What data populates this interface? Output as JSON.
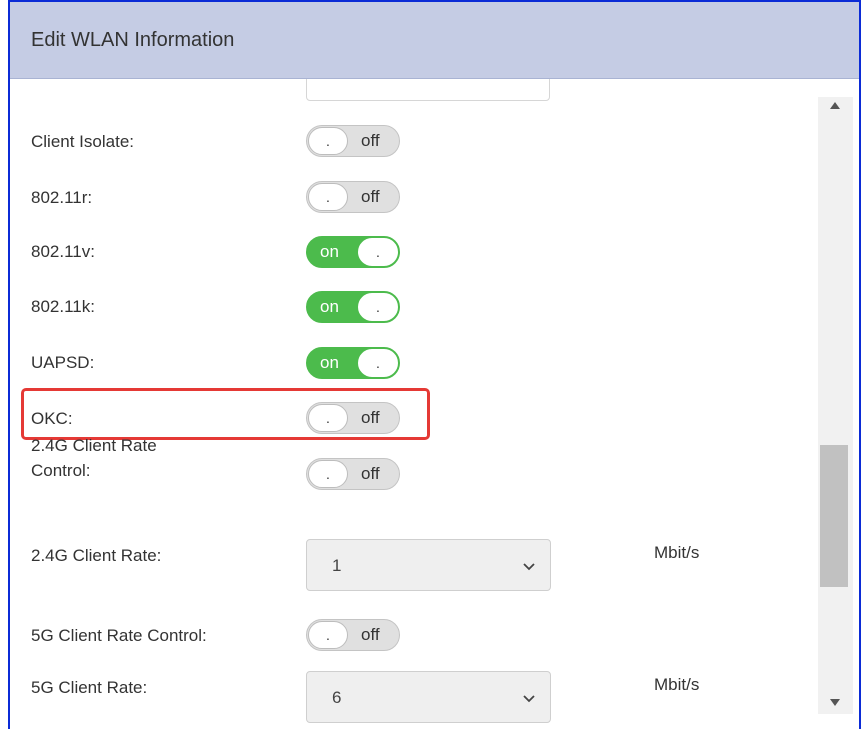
{
  "dialog": {
    "title": "Edit WLAN Information"
  },
  "rows": [
    {
      "label": "Client Isolate:",
      "state": "off",
      "knob": "."
    },
    {
      "label": "802.11r:",
      "state": "off",
      "knob": "."
    },
    {
      "label": "802.11v:",
      "state": "on",
      "knob": "."
    },
    {
      "label": "802.11k:",
      "state": "on",
      "knob": "."
    },
    {
      "label": "UAPSD:",
      "state": "on",
      "knob": "."
    },
    {
      "label": "OKC:",
      "state": "off",
      "knob": "."
    },
    {
      "label": "2.4G Client Rate",
      "label_line2": "Control:",
      "state": "off",
      "knob": "."
    },
    {
      "label": "5G Client Rate Control:",
      "state": "off",
      "knob": "."
    }
  ],
  "rates": [
    {
      "label": "2.4G Client Rate:",
      "value": "1",
      "unit": "Mbit/s"
    },
    {
      "label": "5G Client Rate:",
      "value": "6",
      "unit": "Mbit/s"
    }
  ],
  "colors": {
    "header_bg": "#c5cce4",
    "on_green": "#4cbb4c",
    "highlight_red": "#e53935",
    "border_blue": "#0b2bd6"
  },
  "icons": {
    "select": "chevron-down-icon",
    "scroll_up": "arrow-up-icon",
    "scroll_down": "arrow-down-icon"
  }
}
